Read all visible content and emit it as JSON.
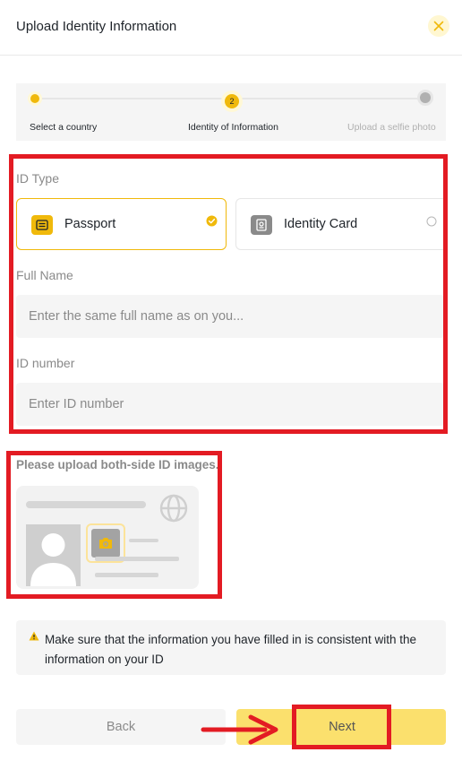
{
  "header": {
    "title": "Upload Identity Information",
    "close_icon": "close-icon"
  },
  "stepper": {
    "steps": [
      {
        "label": "Select a country",
        "state": "completed"
      },
      {
        "label": "Identity of Information",
        "state": "current",
        "number": "2"
      },
      {
        "label": "Upload a selfie photo",
        "state": "upcoming"
      }
    ]
  },
  "form": {
    "id_type_label": "ID Type",
    "id_types": [
      {
        "label": "Passport",
        "icon": "passport-icon",
        "selected": true
      },
      {
        "label": "Identity Card",
        "icon": "id-card-icon",
        "selected": false
      }
    ],
    "full_name": {
      "label": "Full Name",
      "placeholder": "Enter the same full name as on you...",
      "value": ""
    },
    "id_number": {
      "label": "ID number",
      "placeholder": "Enter ID number",
      "value": ""
    }
  },
  "upload": {
    "label": "Please upload both-side ID images.",
    "icon": "camera-icon"
  },
  "notice": {
    "icon": "warning-icon",
    "text": "Make sure that the information you have filled in is consistent with the information on your ID"
  },
  "actions": {
    "back_label": "Back",
    "next_label": "Next"
  },
  "colors": {
    "accent": "#f0b90b",
    "highlight": "#e31b23",
    "next_bg": "#fbe06d"
  }
}
